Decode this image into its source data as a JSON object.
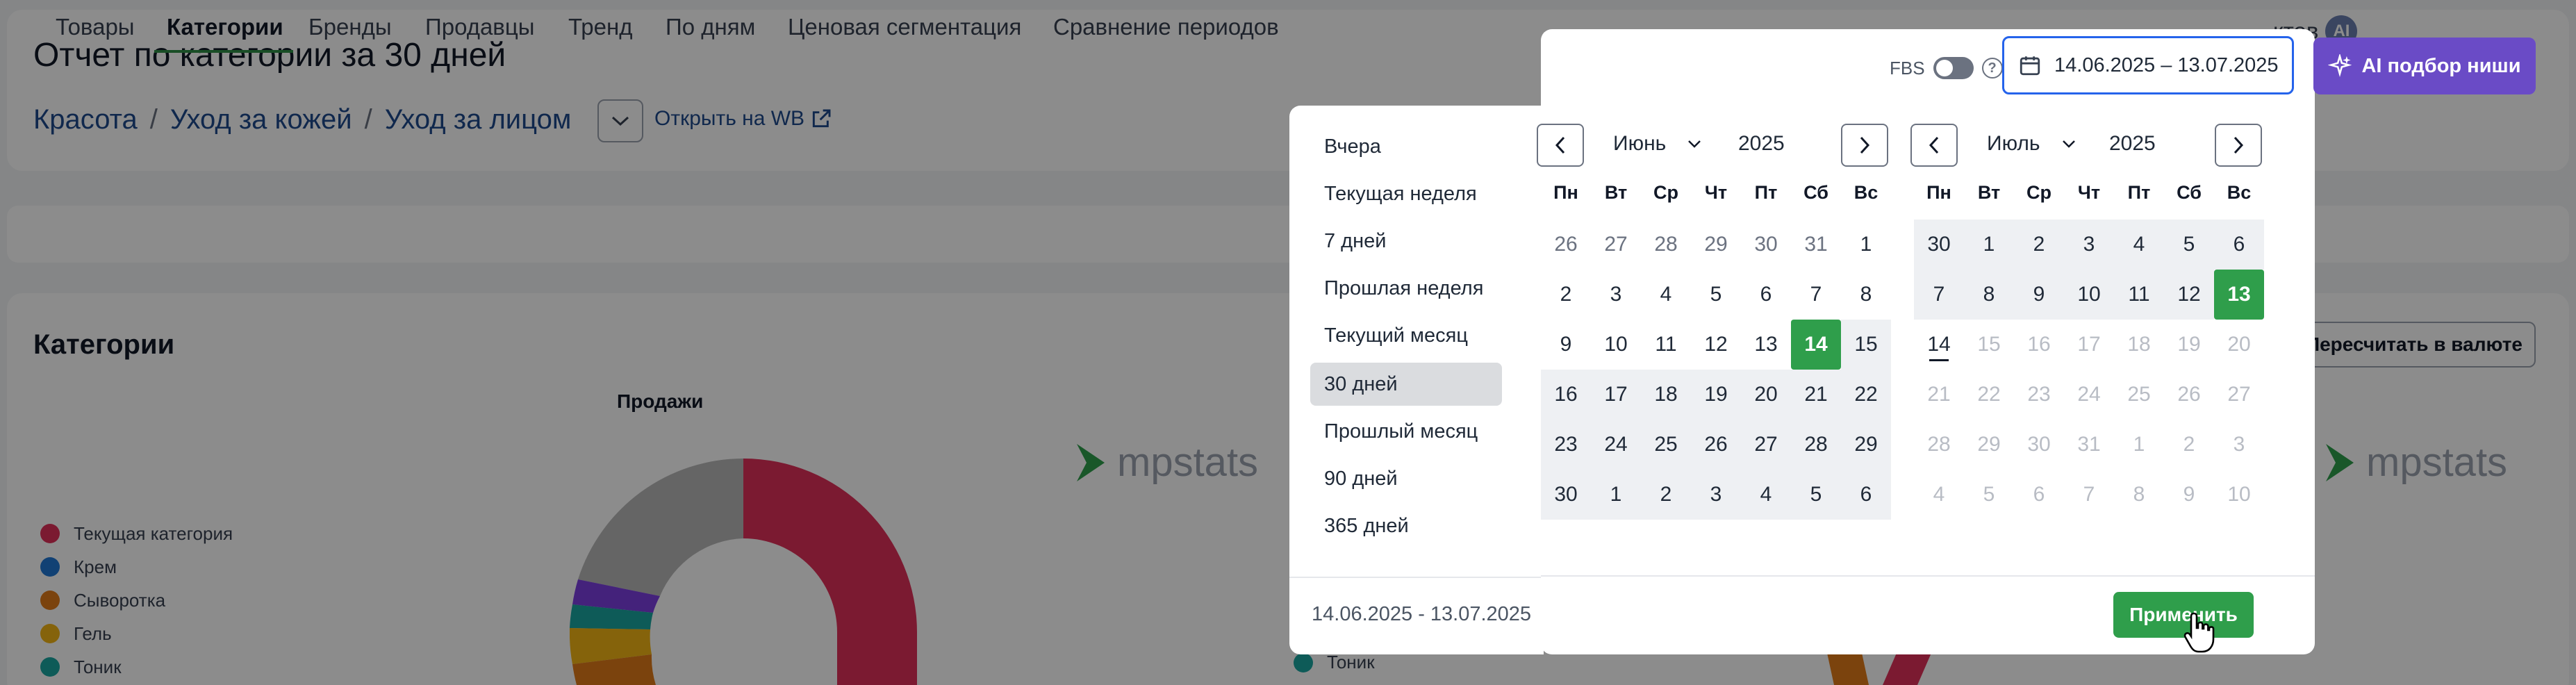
{
  "report": {
    "title": "Отчет по категории за 30 дней",
    "breadcrumb": [
      "Красота",
      "Уход за кожей",
      "Уход за лицом"
    ],
    "breadcrumb_sep": "/",
    "open_wb": "Открыть на WB"
  },
  "tabs": [
    {
      "label": "Товары",
      "active": false
    },
    {
      "label": "Категории",
      "active": true
    },
    {
      "label": "Бренды",
      "active": false
    },
    {
      "label": "Продавцы",
      "active": false
    },
    {
      "label": "Тренд",
      "active": false
    },
    {
      "label": "По дням",
      "active": false
    },
    {
      "label": "Ценовая сегментация",
      "active": false
    },
    {
      "label": "Сравнение периодов",
      "active": false
    }
  ],
  "tab_right": {
    "label": "ктов",
    "badge": "AI"
  },
  "categories": {
    "title": "Категории",
    "sales_title": "Продажи",
    "recalc_label": "Пересчитать в валюте",
    "watermark": "mpstats",
    "legend": [
      {
        "label": "Текущая категория",
        "color": "#e0315a"
      },
      {
        "label": "Крем",
        "color": "#1f77d4"
      },
      {
        "label": "Сыворотка",
        "color": "#e07b18"
      },
      {
        "label": "Гель",
        "color": "#f2b414"
      },
      {
        "label": "Тоник",
        "color": "#1aa6a0"
      }
    ],
    "legend2": {
      "label": "Тоник",
      "color": "#1aa6a0"
    }
  },
  "fbs": {
    "label": "FBS",
    "help": "?"
  },
  "date_input": {
    "value": "14.06.2025 – 13.07.2025"
  },
  "ai_button": {
    "label": "AI подбор ниши"
  },
  "presets": {
    "items": [
      {
        "label": "Вчера",
        "active": false
      },
      {
        "label": "Текущая неделя",
        "active": false
      },
      {
        "label": "7 дней",
        "active": false
      },
      {
        "label": "Прошлая неделя",
        "active": false
      },
      {
        "label": "Текущий месяц",
        "active": false
      },
      {
        "label": "30 дней",
        "active": true
      },
      {
        "label": "Прошлый месяц",
        "active": false
      },
      {
        "label": "90 дней",
        "active": false
      },
      {
        "label": "365 дней",
        "active": false
      }
    ],
    "range": "14.06.2025 - 13.07.2025"
  },
  "calendar": {
    "weekdays": [
      "Пн",
      "Вт",
      "Ср",
      "Чт",
      "Пт",
      "Сб",
      "Вс"
    ],
    "months": [
      {
        "month": "Июнь",
        "year": "2025",
        "days": [
          [
            [
              "26",
              "other",
              ""
            ],
            [
              "27",
              "other",
              ""
            ],
            [
              "28",
              "other",
              ""
            ],
            [
              "29",
              "other",
              ""
            ],
            [
              "30",
              "other",
              ""
            ],
            [
              "31",
              "other",
              ""
            ],
            [
              "1",
              "",
              ""
            ]
          ],
          [
            [
              "2",
              "",
              ""
            ],
            [
              "3",
              "",
              ""
            ],
            [
              "4",
              "",
              ""
            ],
            [
              "5",
              "",
              ""
            ],
            [
              "6",
              "",
              ""
            ],
            [
              "7",
              "",
              ""
            ],
            [
              "8",
              "",
              ""
            ]
          ],
          [
            [
              "9",
              "",
              ""
            ],
            [
              "10",
              "",
              ""
            ],
            [
              "11",
              "",
              ""
            ],
            [
              "12",
              "",
              ""
            ],
            [
              "13",
              "",
              ""
            ],
            [
              "14",
              "",
              "sel"
            ],
            [
              "15",
              "",
              "range"
            ]
          ],
          [
            [
              "16",
              "",
              "range"
            ],
            [
              "17",
              "",
              "range"
            ],
            [
              "18",
              "",
              "range"
            ],
            [
              "19",
              "",
              "range"
            ],
            [
              "20",
              "",
              "range"
            ],
            [
              "21",
              "",
              "range"
            ],
            [
              "22",
              "",
              "range"
            ]
          ],
          [
            [
              "23",
              "",
              "range"
            ],
            [
              "24",
              "",
              "range"
            ],
            [
              "25",
              "",
              "range"
            ],
            [
              "26",
              "",
              "range"
            ],
            [
              "27",
              "",
              "range"
            ],
            [
              "28",
              "",
              "range"
            ],
            [
              "29",
              "",
              "range"
            ]
          ],
          [
            [
              "30",
              "",
              "range"
            ],
            [
              "1",
              "",
              "range"
            ],
            [
              "2",
              "",
              "range"
            ],
            [
              "3",
              "",
              "range"
            ],
            [
              "4",
              "",
              "range"
            ],
            [
              "5",
              "",
              "range"
            ],
            [
              "6",
              "",
              "range"
            ]
          ]
        ]
      },
      {
        "month": "Июль",
        "year": "2025",
        "days": [
          [
            [
              "30",
              "",
              "range"
            ],
            [
              "1",
              "",
              "range"
            ],
            [
              "2",
              "",
              "range"
            ],
            [
              "3",
              "",
              "range"
            ],
            [
              "4",
              "",
              "range"
            ],
            [
              "5",
              "",
              "range"
            ],
            [
              "6",
              "",
              "range"
            ]
          ],
          [
            [
              "7",
              "",
              "range"
            ],
            [
              "8",
              "",
              "range"
            ],
            [
              "9",
              "",
              "range"
            ],
            [
              "10",
              "",
              "range"
            ],
            [
              "11",
              "",
              "range"
            ],
            [
              "12",
              "",
              "range"
            ],
            [
              "13",
              "",
              "sel"
            ]
          ],
          [
            [
              "14",
              "today",
              ""
            ],
            [
              "15",
              "disabled",
              ""
            ],
            [
              "16",
              "disabled",
              ""
            ],
            [
              "17",
              "disabled",
              ""
            ],
            [
              "18",
              "disabled",
              ""
            ],
            [
              "19",
              "disabled",
              ""
            ],
            [
              "20",
              "disabled",
              ""
            ]
          ],
          [
            [
              "21",
              "disabled",
              ""
            ],
            [
              "22",
              "disabled",
              ""
            ],
            [
              "23",
              "disabled",
              ""
            ],
            [
              "24",
              "disabled",
              ""
            ],
            [
              "25",
              "disabled",
              ""
            ],
            [
              "26",
              "disabled",
              ""
            ],
            [
              "27",
              "disabled",
              ""
            ]
          ],
          [
            [
              "28",
              "disabled",
              ""
            ],
            [
              "29",
              "disabled",
              ""
            ],
            [
              "30",
              "disabled",
              ""
            ],
            [
              "31",
              "disabled",
              ""
            ],
            [
              "1",
              "disabled",
              ""
            ],
            [
              "2",
              "disabled",
              ""
            ],
            [
              "3",
              "disabled",
              ""
            ]
          ],
          [
            [
              "4",
              "disabled",
              ""
            ],
            [
              "5",
              "disabled",
              ""
            ],
            [
              "6",
              "disabled",
              ""
            ],
            [
              "7",
              "disabled",
              ""
            ],
            [
              "8",
              "disabled",
              ""
            ],
            [
              "9",
              "disabled",
              ""
            ],
            [
              "10",
              "disabled",
              ""
            ]
          ]
        ]
      }
    ],
    "apply_label": "Применить"
  }
}
